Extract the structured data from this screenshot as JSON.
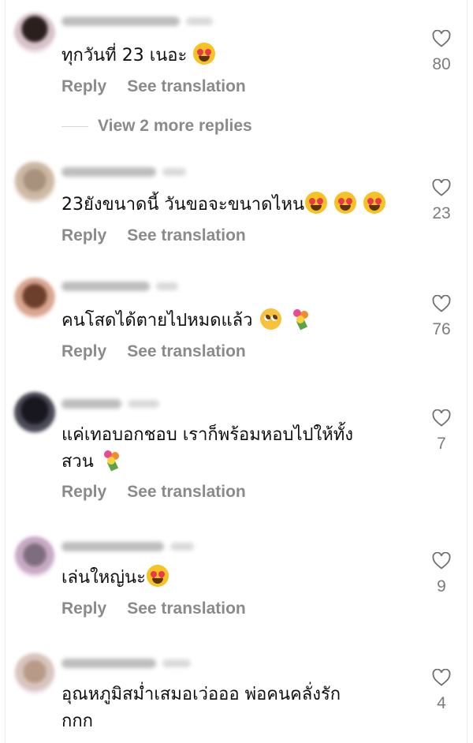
{
  "actions": {
    "reply_label": "Reply",
    "see_translation_label": "See translation"
  },
  "view_more_replies": "View 2 more replies",
  "colors": {
    "action_gray": "#8a8a8a",
    "like_count_gray": "#7c7c7c",
    "background": "#ffffff"
  },
  "comments": [
    {
      "text_parts": [
        "ทุกวันที่ 23 เนอะ ",
        ""
      ],
      "emojis": [
        "heart-eyes"
      ],
      "likes": "80"
    },
    {
      "text_parts": [
        "23ยังขนาดนี้ วันขอจะขนาดไหน",
        ""
      ],
      "emojis": [
        "heart-eyes",
        "heart-eyes",
        "heart-eyes"
      ],
      "likes": "23"
    },
    {
      "text_parts": [
        "คนโสดได้ตายไปหมดแล้ว ",
        ""
      ],
      "emojis": [
        "pleading-face",
        "bouquet"
      ],
      "likes": "76"
    },
    {
      "text_parts": [
        "แค่เทอบอกชอบ เราก็พร้อมหอบไปให้ทั้ง",
        "สวน "
      ],
      "emojis": [
        "bouquet"
      ],
      "likes": "7"
    },
    {
      "text_parts": [
        "เล่นใหญ่นะ",
        ""
      ],
      "emojis": [
        "heart-eyes"
      ],
      "likes": "9"
    },
    {
      "text_parts": [
        "อุณหภูมิสม่ำเสมอเว่อออ พ่อคนคลั่งรัก",
        "กกก"
      ],
      "emojis": [],
      "likes": "4"
    }
  ],
  "icons": {
    "like": "heart-outline-icon"
  }
}
